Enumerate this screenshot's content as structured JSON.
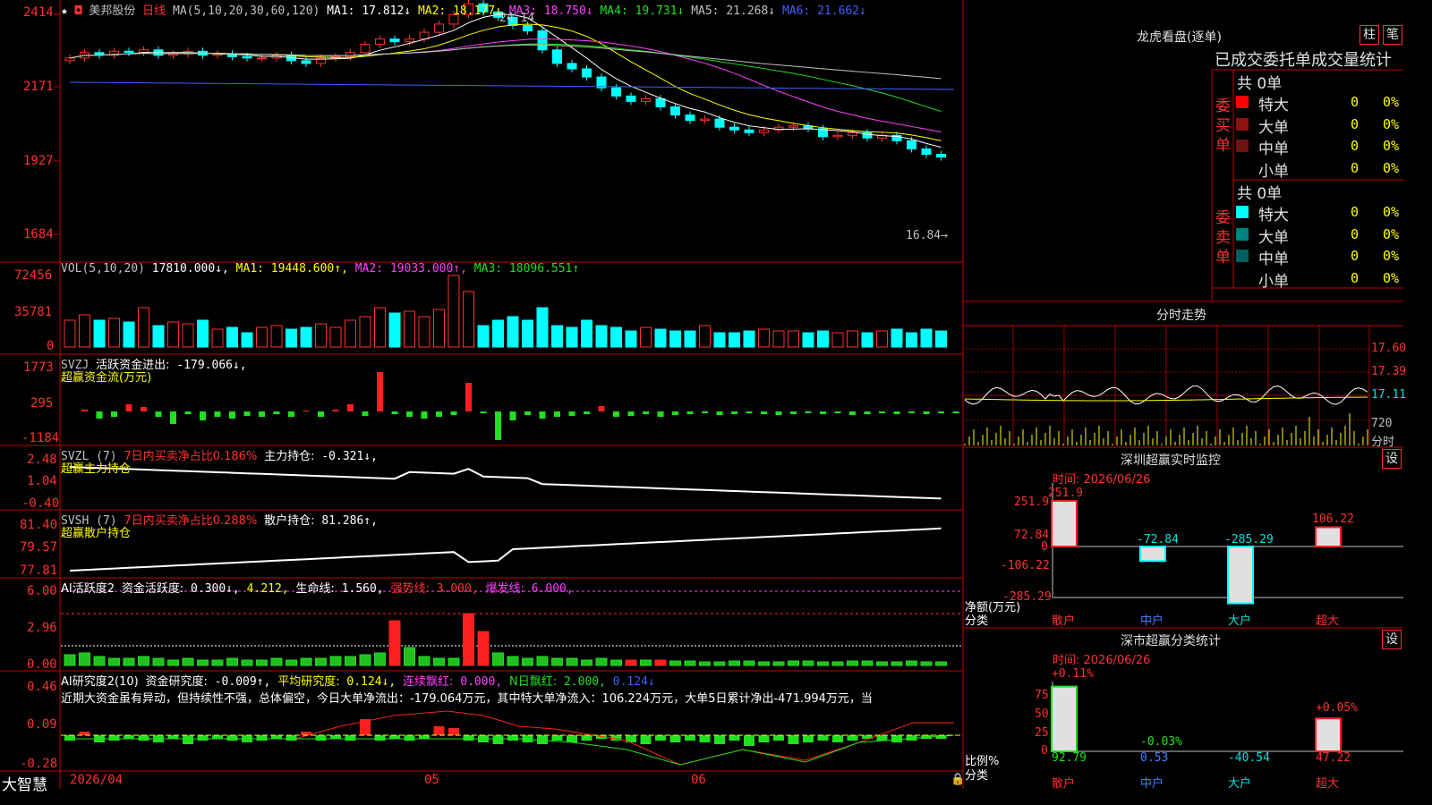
{
  "chart": {
    "stock_name": "美邦股份",
    "period": "日线",
    "ma_header": "MA(5,10,20,30,60,120)",
    "ma": [
      {
        "label": "MA1:",
        "value": "17.812↓",
        "color": "#ffffff"
      },
      {
        "label": "MA2:",
        "value": "18.177↓",
        "color": "#ffff00"
      },
      {
        "label": "MA3:",
        "value": "18.750↓",
        "color": "#ff40ff"
      },
      {
        "label": "MA4:",
        "value": "19.731↓",
        "color": "#20e020"
      },
      {
        "label": "MA5:",
        "value": "21.268↓",
        "color": "#c0c0c0"
      },
      {
        "label": "MA6:",
        "value": "21.662↓",
        "color": "#4060ff"
      }
    ],
    "high_marker": "24.14",
    "low_marker": "16.84",
    "price_axis": [
      "2414",
      "2171",
      "1927",
      "1684"
    ],
    "vol_header": "VOL(5,10,20)",
    "vol_value": "17810.000↓,",
    "vol_ma": [
      {
        "label": "MA1:",
        "value": "19448.600↑,",
        "color": "#ffff00"
      },
      {
        "label": "MA2:",
        "value": "19033.000↑,",
        "color": "#ff40ff"
      },
      {
        "label": "MA3:",
        "value": "18096.551↑",
        "color": "#20e020"
      }
    ],
    "vol_axis": [
      "72456",
      "35781",
      "0"
    ],
    "svzj": {
      "name": "SVZJ",
      "label": "活跃资金进出:",
      "value": "-179.066↓,",
      "sub": "超赢资金流(万元)",
      "axis": [
        "1773",
        "295",
        "-1184"
      ]
    },
    "svzl": {
      "name": "SVZL (7)",
      "ratio": "7日内买卖净占比0.186%",
      "label": "主力持仓:",
      "value": "-0.321↓,",
      "sub": "超赢主力持仓",
      "axis": [
        "2.48",
        "1.04",
        "-0.40"
      ]
    },
    "svsh": {
      "name": "SVSH (7)",
      "ratio": "7日内买卖净占比0.288%",
      "label": "散户持仓:",
      "value": "81.286↑,",
      "sub": "超赢散户持仓",
      "axis": [
        "81.40",
        "79.57",
        "77.81"
      ]
    },
    "ai1": {
      "name": "AI活跃度2",
      "a": "资金活跃度:",
      "a_val": "0.300↓,",
      "b_val": "4.212,",
      "c": "生命线:",
      "c_val": "1.560,",
      "d": "强势线:",
      "d_val": "3.000,",
      "e": "爆发线:",
      "e_val": "6.000,",
      "axis": [
        "6.00",
        "2.96",
        "0.00"
      ]
    },
    "ai2": {
      "name": "AI研究度2(10)",
      "a": "资金研究度:",
      "a_val": "-0.009↑,",
      "b": "平均研究度:",
      "b_val": "0.124↓,",
      "c": "连续飘红:",
      "c_val": "0.000,",
      "d": "N日飘红:",
      "d_val": "2.000,",
      "e_val": "0.124↓",
      "axis": [
        "0.46",
        "0.09",
        "-0.28"
      ],
      "comment": "近期大资金虽有异动，但持续性不强，总体偏空，今日大单净流出：-179.064万元，其中特大单净流入：106.224万元，大单5日累计净出-471.994万元，当"
    },
    "dates": [
      "2026/04",
      "05",
      "06"
    ],
    "brand": "大智慧"
  },
  "longhu": {
    "title": "龙虎看盘(逐单)",
    "btn1": "柱",
    "btn2": "笔",
    "subtitle": "已成交委托单成交量统计",
    "buy_side": "委买单",
    "sell_side": "委卖单",
    "buy_total": "共 0单",
    "sell_total": "共 0单",
    "buy_rows": [
      {
        "name": "特大",
        "val": "0",
        "pct": "0%",
        "color": "#ff0000"
      },
      {
        "name": "大单",
        "val": "0",
        "pct": "0%",
        "color": "#901010"
      },
      {
        "name": "中单",
        "val": "0",
        "pct": "0%",
        "color": "#701010"
      },
      {
        "name": "小单",
        "val": "0",
        "pct": "0%",
        "color": "#000000"
      }
    ],
    "sell_rows": [
      {
        "name": "特大",
        "val": "0",
        "pct": "0%",
        "color": "#00ffff"
      },
      {
        "name": "大单",
        "val": "0",
        "pct": "0%",
        "color": "#008080"
      },
      {
        "name": "中单",
        "val": "0",
        "pct": "0%",
        "color": "#006060"
      },
      {
        "name": "小单",
        "val": "0",
        "pct": "0%",
        "color": "#000000"
      }
    ]
  },
  "fenshi": {
    "title": "分时走势",
    "axis": [
      "17.60",
      "17.39",
      "17.11"
    ],
    "vol_axis": "720",
    "vol_label": "分时"
  },
  "sz_monitor": {
    "title": "深圳超赢实时监控",
    "btn": "设",
    "time": "时间: 2026/06/26",
    "axis": [
      "251.9",
      "72.84",
      "0",
      "-106.22",
      "-285.29"
    ],
    "unit": "净额(万元)",
    "cat_label": "分类",
    "bars": [
      {
        "label": "散户",
        "value": 251.9,
        "text": "251.9"
      },
      {
        "label": "中户",
        "value": -72.84,
        "text": "-72.84"
      },
      {
        "label": "大户",
        "value": -285.29,
        "text": "-285.29"
      },
      {
        "label": "超大",
        "value": 106.22,
        "text": "106.22"
      }
    ]
  },
  "sz_class": {
    "title": "深市超赢分类统计",
    "btn": "设",
    "time": "时间: 2026/06/26",
    "axis": [
      "75",
      "50",
      "25",
      "0"
    ],
    "unit": "比例%",
    "cat_label": "分类",
    "tops": [
      "+0.11%",
      "-0.03%",
      "",
      "+0.05%"
    ],
    "bars": [
      {
        "label": "散户",
        "value": 92.79,
        "text": "92.79"
      },
      {
        "label": "中户",
        "value": 0.53,
        "text": "0.53"
      },
      {
        "label": "大户",
        "value": -40.54,
        "text": "-40.54"
      },
      {
        "label": "超大",
        "value": 47.22,
        "text": "47.22"
      }
    ]
  }
}
